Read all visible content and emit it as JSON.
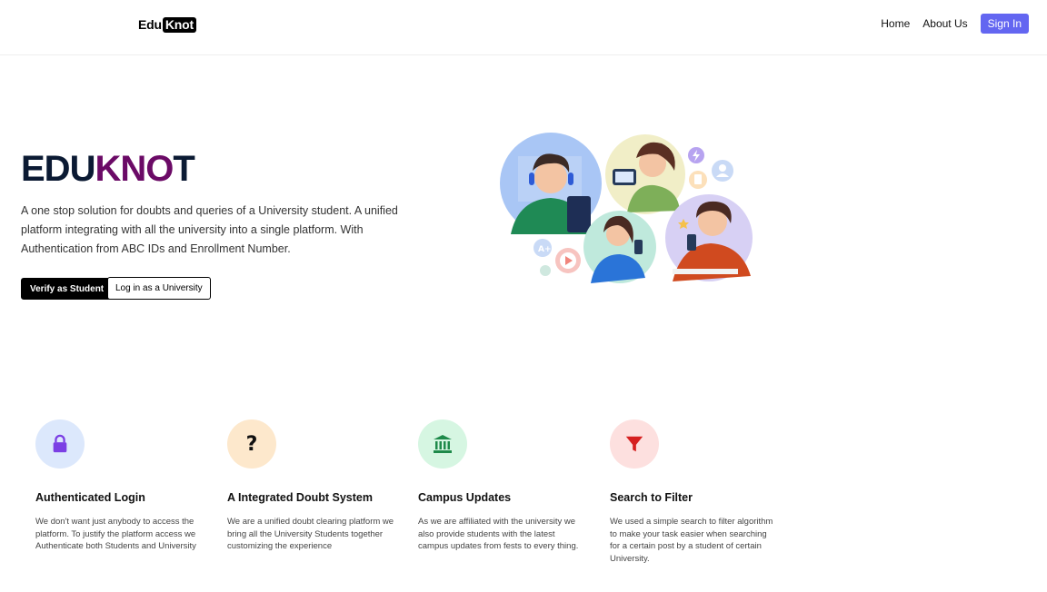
{
  "nav": {
    "logo_part1": "Edu",
    "logo_part2": "Knot",
    "links": [
      "Home",
      "About Us"
    ],
    "signin_label": "Sign In"
  },
  "hero": {
    "title_part1": "EDU",
    "title_part2": "KNO",
    "title_part3": "T",
    "description": "A one stop solution for doubts and queries of a University student. A unified platform integrating with all the university into a single platform. With Authentication from ABC IDs and Enrollment Number.",
    "verify_button": "Verify as Student",
    "university_button": "Log in as a University"
  },
  "features": [
    {
      "icon": "lock-icon",
      "title": "Authenticated Login",
      "description": "We don't want just anybody to access the platform. To justify the platform access we Authenticate both Students and University"
    },
    {
      "icon": "question-icon",
      "title": "A Integrated Doubt System",
      "description": "We are a unified doubt clearing platform we bring all the University Students together customizing the experience"
    },
    {
      "icon": "bank-icon",
      "title": "Campus Updates",
      "description": "As we are affiliated with the university we also provide students with the latest campus updates from fests to every thing."
    },
    {
      "icon": "filter-icon",
      "title": "Search to Filter",
      "description": "We used a simple search to filter algorithm to make your task easier when searching for a certain post by a student of certain University."
    }
  ],
  "colors": {
    "accent": "#6366f1",
    "title_purple": "#6b0a66",
    "title_navy": "#0b1a33"
  }
}
